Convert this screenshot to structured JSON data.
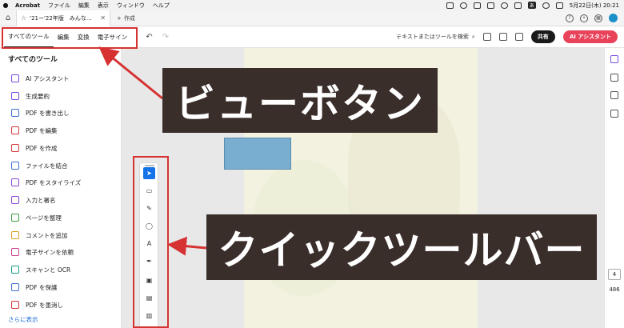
{
  "menubar": {
    "app": "Acrobat",
    "items": [
      "ファイル",
      "編集",
      "表示",
      "ウィンドウ",
      "ヘルプ"
    ],
    "ime": "あ",
    "clock": "5月22日(木) 20:21"
  },
  "tabbar": {
    "doc_title": "'21ー'22年版　みんな…",
    "new_tab_label": "作成"
  },
  "toolbar": {
    "view_tabs": [
      "すべてのツール",
      "編集",
      "変換",
      "電子サイン"
    ],
    "search_label": "テキストまたはツールを検索",
    "share_label": "共有",
    "ai_label": "AI アシスタント"
  },
  "leftpanel": {
    "title": "すべてのツール",
    "tools": [
      {
        "label": "AI アシスタント",
        "icon": "ai-assistant-icon",
        "color": "#7a4be0"
      },
      {
        "label": "生成要約",
        "icon": "summary-icon",
        "color": "#7a4be0"
      },
      {
        "label": "PDF を書き出し",
        "icon": "export-pdf-icon",
        "color": "#3c6fd6"
      },
      {
        "label": "PDF を編集",
        "icon": "edit-pdf-icon",
        "color": "#d23a3a"
      },
      {
        "label": "PDF を作成",
        "icon": "create-pdf-icon",
        "color": "#d23a3a"
      },
      {
        "label": "ファイルを結合",
        "icon": "combine-files-icon",
        "color": "#3c6fd6"
      },
      {
        "label": "PDF をスタイライズ",
        "icon": "stylize-pdf-icon",
        "color": "#8a4ad9"
      },
      {
        "label": "入力と署名",
        "icon": "fill-sign-icon",
        "color": "#8a4ad9"
      },
      {
        "label": "ページを整理",
        "icon": "organize-pages-icon",
        "color": "#3a9b3a"
      },
      {
        "label": "コメントを追加",
        "icon": "comment-icon",
        "color": "#d6a21e"
      },
      {
        "label": "電子サインを依頼",
        "icon": "request-signature-icon",
        "color": "#c8448f"
      },
      {
        "label": "スキャンと OCR",
        "icon": "scan-ocr-icon",
        "color": "#1d9c8a"
      },
      {
        "label": "PDF を保護",
        "icon": "protect-pdf-icon",
        "color": "#3c6fd6"
      },
      {
        "label": "PDF を墨消し",
        "icon": "redact-pdf-icon",
        "color": "#d23a3a"
      }
    ],
    "more_link": "さらに表示"
  },
  "rightrail": {
    "current_page": "4",
    "total_pages": "486"
  },
  "annotations": {
    "view_buttons": "ビューボタン",
    "quick_toolbar": "クイックツールバー"
  }
}
